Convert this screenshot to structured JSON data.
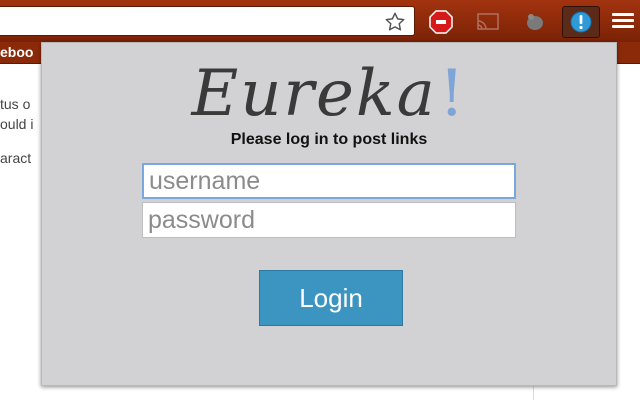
{
  "browser": {
    "address_text": "",
    "bookmark_text": "eboo",
    "extensions": [
      "stop-icon",
      "cast-icon",
      "gray-extension-icon",
      "eureka-extension-icon"
    ],
    "menu_icon": "hamburger-menu-icon"
  },
  "background_page": {
    "fragments": [
      "tus o",
      "ould i",
      "aract"
    ]
  },
  "popup": {
    "logo_text": "Eureka",
    "logo_mark": "!",
    "subtitle": "Please log in to post links",
    "username_placeholder": "username",
    "password_placeholder": "password",
    "login_label": "Login"
  },
  "colors": {
    "toolbar": "#a2330f",
    "popup_background": "#d2d2d4",
    "login_button": "#3c94c0",
    "logo_mark": "#7fa4d8",
    "focus_border": "#7aa7dd"
  }
}
